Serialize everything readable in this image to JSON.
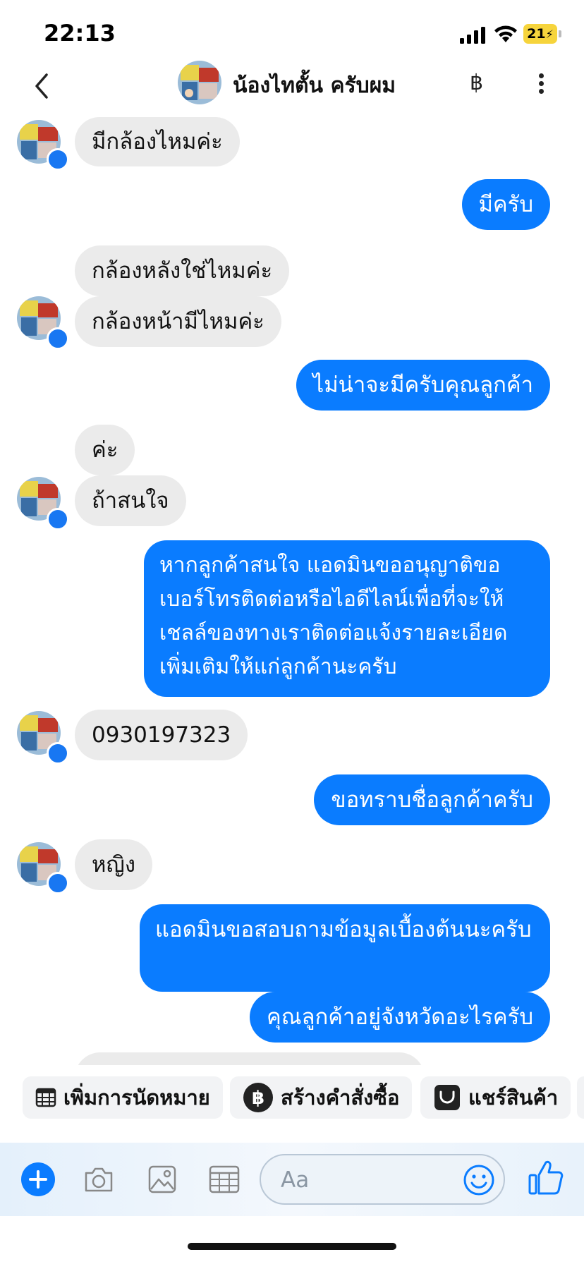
{
  "status_bar": {
    "time": "22:13",
    "battery": "21"
  },
  "header": {
    "contact_name": "น้องไทตั้น ครับผม",
    "baht_symbol": "฿"
  },
  "messages": [
    {
      "dir": "in",
      "text": "มีกล้องไหมค่ะ"
    },
    {
      "dir": "out",
      "text": "มีครับ"
    },
    {
      "dir": "in",
      "text": "กล้องหลังใช่ไหมค่ะ"
    },
    {
      "dir": "in",
      "text": "กล้องหน้ามีไหมค่ะ"
    },
    {
      "dir": "out",
      "text": "ไม่น่าจะมีครับคุณลูกค้า"
    },
    {
      "dir": "in",
      "text": "ค่ะ"
    },
    {
      "dir": "in",
      "text": "ถ้าสนใจ"
    },
    {
      "dir": "out",
      "text": "หากลูกค้าสนใจ แอดมินขออนุญาติขอเบอร์โทรติดต่อหรือไอดีไลน์เพื่อที่จะให้เชลล์ของทางเราติดต่อแจ้งรายละเอียดเพิ่มเติมให้แก่ลูกค้านะครับ"
    },
    {
      "dir": "in",
      "text": "0930197323"
    },
    {
      "dir": "out",
      "text": "ขอทราบชื่อลูกค้าครับ"
    },
    {
      "dir": "in",
      "text": "หญิง"
    },
    {
      "dir": "out",
      "text": "แอดมินขอสอบถามข้อมูลเบื้องต้นนะครับ"
    },
    {
      "dir": "out",
      "text": "คุณลูกค้าอยู่จังหวัดอะไรครับ"
    }
  ],
  "quick_actions": [
    {
      "label": "เพิ่มการนัดหมาย",
      "icon": "calendar-icon"
    },
    {
      "label": "สร้างคำสั่งซื้อ",
      "icon": "baht-circle-icon"
    },
    {
      "label": "แชร์สินค้า",
      "icon": "shopping-bag-icon"
    }
  ],
  "composer": {
    "placeholder": "Aa"
  },
  "colors": {
    "accent": "#0a7cff",
    "incoming_bubble": "#ebebeb"
  }
}
